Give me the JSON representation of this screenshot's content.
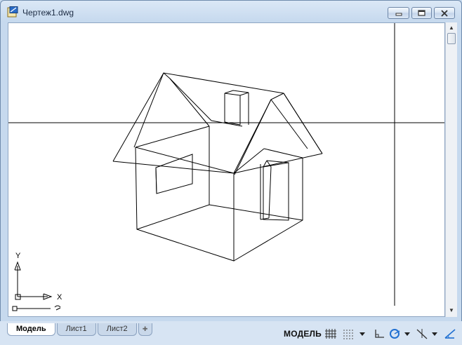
{
  "window": {
    "title": "Чертеж1.dwg"
  },
  "tabs": [
    {
      "label": "Модель",
      "active": true
    },
    {
      "label": "Лист1",
      "active": false
    },
    {
      "label": "Лист2",
      "active": false
    }
  ],
  "statusbar": {
    "space_label": "МОДЕЛЬ",
    "icons": [
      "grid-icon",
      "snap-icon",
      "dropdown-icon",
      "ortho-icon",
      "polar-icon",
      "object-snap-icon",
      "dynamic-ucs-icon"
    ]
  },
  "ucs": {
    "x_label": "X",
    "y_label": "Y"
  },
  "colors": {
    "canvas": "#ffffff",
    "lines": "#000000",
    "frame": "#c6d9ee",
    "accent": "#1f6fd1"
  }
}
